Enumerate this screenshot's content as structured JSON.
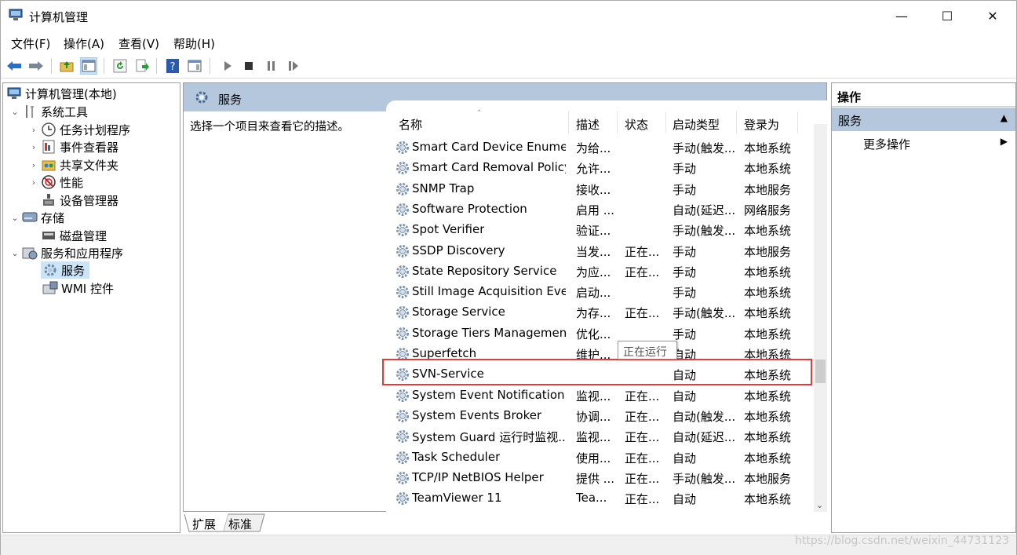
{
  "window": {
    "title": "计算机管理",
    "controls": {
      "minimize": "—",
      "maximize": "☐",
      "close": "✕"
    }
  },
  "menu": [
    "文件(F)",
    "操作(A)",
    "查看(V)",
    "帮助(H)"
  ],
  "tree": {
    "root": "计算机管理(本地)",
    "items": [
      {
        "label": "系统工具",
        "level": 1,
        "expander": "⌄"
      },
      {
        "label": "任务计划程序",
        "level": 2,
        "expander": "›"
      },
      {
        "label": "事件查看器",
        "level": 2,
        "expander": "›"
      },
      {
        "label": "共享文件夹",
        "level": 2,
        "expander": "›"
      },
      {
        "label": "性能",
        "level": 2,
        "expander": "›"
      },
      {
        "label": "设备管理器",
        "level": 2,
        "expander": ""
      },
      {
        "label": "存储",
        "level": 1,
        "expander": "⌄"
      },
      {
        "label": "磁盘管理",
        "level": 2,
        "expander": ""
      },
      {
        "label": "服务和应用程序",
        "level": 1,
        "expander": "⌄"
      },
      {
        "label": "服务",
        "level": 2,
        "expander": "",
        "selected": true
      },
      {
        "label": "WMI 控件",
        "level": 2,
        "expander": ""
      }
    ]
  },
  "services_panel": {
    "title": "服务",
    "description_hint": "选择一个项目来查看它的描述。",
    "columns": [
      "名称",
      "描述",
      "状态",
      "启动类型",
      "登录为"
    ],
    "rows": [
      [
        "Smart Card Device Enumer...",
        "为给...",
        "",
        "手动(触发...",
        "本地系统"
      ],
      [
        "Smart Card Removal Policy",
        "允许...",
        "",
        "手动",
        "本地系统"
      ],
      [
        "SNMP Trap",
        "接收...",
        "",
        "手动",
        "本地服务"
      ],
      [
        "Software Protection",
        "启用 ...",
        "",
        "自动(延迟...",
        "网络服务"
      ],
      [
        "Spot Verifier",
        "验证...",
        "",
        "手动(触发...",
        "本地系统"
      ],
      [
        "SSDP Discovery",
        "当发...",
        "正在...",
        "手动",
        "本地服务"
      ],
      [
        "State Repository Service",
        "为应...",
        "正在...",
        "手动",
        "本地系统"
      ],
      [
        "Still Image Acquisition Eve...",
        "启动...",
        "",
        "手动",
        "本地系统"
      ],
      [
        "Storage Service",
        "为存...",
        "正在...",
        "手动(触发...",
        "本地系统"
      ],
      [
        "Storage Tiers Management",
        "优化...",
        "",
        "手动",
        "本地系统"
      ],
      [
        "Superfetch",
        "维护...",
        "",
        "自动",
        "本地系统"
      ],
      [
        "SVN-Service",
        "",
        "",
        "自动",
        "本地系统"
      ],
      [
        "System Event Notification ...",
        "监视...",
        "正在...",
        "自动",
        "本地系统"
      ],
      [
        "System Events Broker",
        "协调...",
        "正在...",
        "自动(触发...",
        "本地系统"
      ],
      [
        "System Guard 运行时监视...",
        "监视...",
        "正在...",
        "自动(延迟...",
        "本地系统"
      ],
      [
        "Task Scheduler",
        "使用...",
        "正在...",
        "自动",
        "本地系统"
      ],
      [
        "TCP/IP NetBIOS Helper",
        "提供 ...",
        "正在...",
        "手动(触发...",
        "本地服务"
      ],
      [
        "TeamViewer 11",
        "Tea...",
        "正在...",
        "自动",
        "本地系统"
      ]
    ],
    "tooltip": "正在运行",
    "tabs": [
      "扩展",
      "标准"
    ]
  },
  "actions": {
    "header": "操作",
    "section": "服务",
    "items": [
      "更多操作"
    ]
  },
  "watermark": "https://blog.csdn.net/weixin_44731123",
  "colors": {
    "header_band": "#b4c7dd",
    "selection": "#cce4f7",
    "highlight_box": "#e23b3b"
  }
}
